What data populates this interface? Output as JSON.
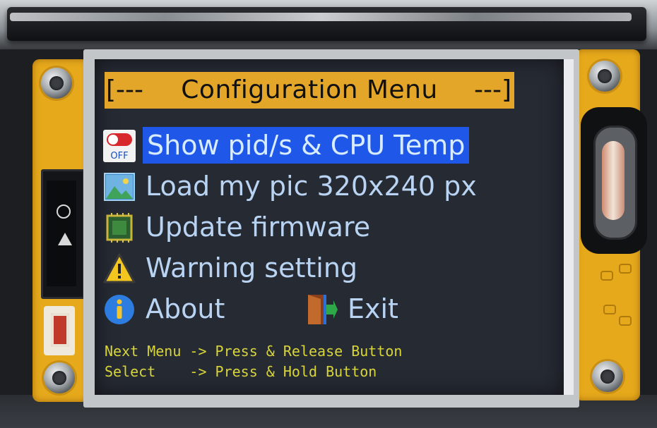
{
  "menu": {
    "title_left": "[---",
    "title": "Configuration Menu",
    "title_right": "---]",
    "items": [
      {
        "label": "Show pid/s & CPU Temp",
        "icon": "toggle-off-icon",
        "icon_text": "OFF",
        "selected": true
      },
      {
        "label": "Load my pic 320x240 px",
        "icon": "image-icon",
        "selected": false
      },
      {
        "label": "Update firmware",
        "icon": "chip-icon",
        "selected": false
      },
      {
        "label": "Warning setting",
        "icon": "warning-icon",
        "selected": false
      },
      {
        "label": "About",
        "icon": "info-icon",
        "selected": false
      },
      {
        "label": "Exit",
        "icon": "exit-door-icon",
        "selected": false
      }
    ]
  },
  "hints": {
    "line1": "Next Menu -> Press & Release Button",
    "line2": "Select    -> Press & Hold Button"
  },
  "colors": {
    "title_bar": "#e3a628",
    "selection": "#1f57e8",
    "menu_text": "#b9d3f2",
    "hint_text": "#d8d53a",
    "screen_bg": "#262a33"
  }
}
